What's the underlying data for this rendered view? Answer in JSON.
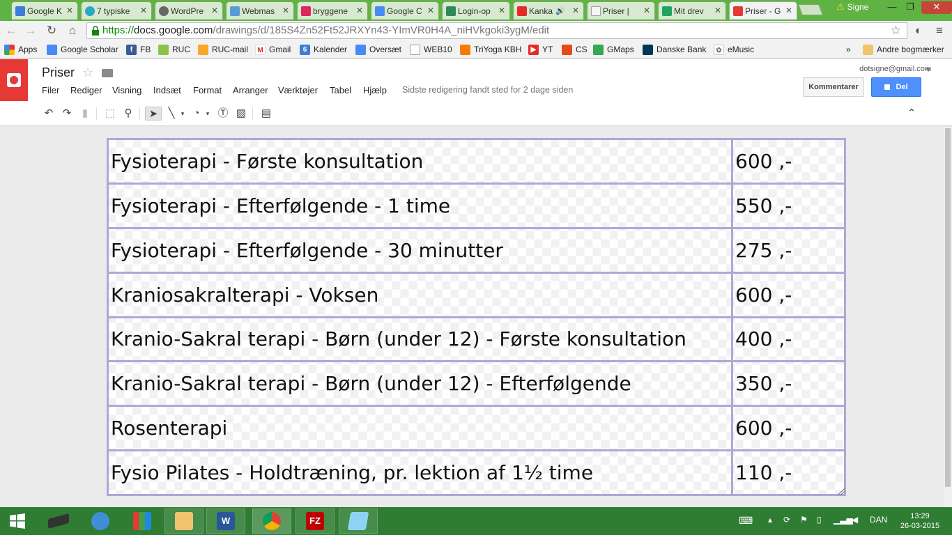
{
  "browser": {
    "tabs": [
      {
        "label": "Google K",
        "icon": "calendar-icon",
        "color": "#3d7dd8"
      },
      {
        "label": "7 typiske",
        "icon": "d-logo-icon",
        "color": "#2aa7c9"
      },
      {
        "label": "WordPre",
        "icon": "wordpress-icon",
        "color": "#666666"
      },
      {
        "label": "Webmas",
        "icon": "webmaster-icon",
        "color": "#5b9bd5"
      },
      {
        "label": "bryggene",
        "icon": "n-logo-icon",
        "color": "#e0245e"
      },
      {
        "label": "Google C",
        "icon": "translate-icon",
        "color": "#4a8af4"
      },
      {
        "label": "Login-op",
        "icon": "g-logo-icon",
        "color": "#2e8b57"
      },
      {
        "label": "Kanka",
        "icon": "youtube-icon",
        "color": "#e52d27"
      },
      {
        "label": "Priser |",
        "icon": "document-icon",
        "color": "#9e9e9e"
      },
      {
        "label": "Mit drev",
        "icon": "drive-icon",
        "color": "#1fa463"
      },
      {
        "label": "Priser - G",
        "icon": "drawings-icon",
        "color": "#e53935"
      }
    ],
    "user_badge": "Signe",
    "url_https": "https://",
    "url_host": "docs.google.com",
    "url_path": "/drawings/d/185S4Zn52Ft52JRXYn43-YImVR0H4A_niHVkgoki3ygM/edit",
    "bookmarks": [
      {
        "label": "Apps",
        "icon": "apps-icon",
        "color": "#e53935"
      },
      {
        "label": "Google Scholar",
        "icon": "scholar-icon",
        "color": "#4a8af4"
      },
      {
        "label": "FB",
        "icon": "facebook-icon",
        "color": "#3b5998"
      },
      {
        "label": "RUC",
        "icon": "ruc-icon",
        "color": "#8bc34a"
      },
      {
        "label": "RUC-mail",
        "icon": "ruc-mail-icon",
        "color": "#f9a825"
      },
      {
        "label": "Gmail",
        "icon": "gmail-icon",
        "color": "#d93025"
      },
      {
        "label": "Kalender",
        "icon": "calendar-icon",
        "color": "#3d7dd8"
      },
      {
        "label": "Oversæt",
        "icon": "translate-icon",
        "color": "#4a8af4"
      },
      {
        "label": "WEB10",
        "icon": "mail-icon",
        "color": "#9e9e9e"
      },
      {
        "label": "TriYoga KBH",
        "icon": "triyoga-icon",
        "color": "#f57c00"
      },
      {
        "label": "YT",
        "icon": "youtube-icon",
        "color": "#e52d27"
      },
      {
        "label": "CS",
        "icon": "cs-icon",
        "color": "#e64a19"
      },
      {
        "label": "GMaps",
        "icon": "maps-icon",
        "color": "#34a853"
      },
      {
        "label": "Danske Bank",
        "icon": "bank-icon",
        "color": "#003755"
      },
      {
        "label": "eMusic",
        "icon": "emusic-icon",
        "color": "#777777"
      }
    ],
    "other_bookmarks": "Andre bogmærker",
    "more_bookmarks": "»"
  },
  "docs": {
    "title": "Priser",
    "menus": [
      "Filer",
      "Rediger",
      "Visning",
      "Indsæt",
      "Format",
      "Arranger",
      "Værktøjer",
      "Tabel",
      "Hjælp"
    ],
    "last_edit": "Sidste redigering fandt sted for 2 dage siden",
    "account": "dotsigne@gmail.com",
    "comments_label": "Kommentarer",
    "share_label": "Del"
  },
  "price_table": {
    "rows": [
      {
        "service": "Fysioterapi - Første konsultation",
        "price": "600 ,-"
      },
      {
        "service": "Fysioterapi - Efterfølgende - 1 time",
        "price": "550 ,-"
      },
      {
        "service": "Fysioterapi - Efterfølgende - 30 minutter",
        "price": "275 ,-"
      },
      {
        "service": "Kraniosakralterapi - Voksen",
        "price": "600 ,-"
      },
      {
        "service": "Kranio-Sakral terapi - Børn (under 12) - Første konsultation",
        "price": "400 ,-"
      },
      {
        "service": "Kranio-Sakral terapi - Børn (under 12) - Efterfølgende",
        "price": "350 ,-"
      },
      {
        "service": "Rosenterapi",
        "price": "600 ,-"
      },
      {
        "service": "Fysio Pilates - Holdtræning, pr. lektion af 1½ time",
        "price": "110 ,-"
      }
    ],
    "border_color": "#b2a5d6"
  },
  "taskbar": {
    "language": "DAN",
    "time": "13:29",
    "date": "26-03-2015",
    "apps": [
      {
        "name": "start-button",
        "glyph": ""
      },
      {
        "name": "laptop-app-icon",
        "glyph": ""
      },
      {
        "name": "network-app-icon",
        "glyph": ""
      },
      {
        "name": "tiles-app-icon",
        "glyph": ""
      },
      {
        "name": "file-explorer-icon",
        "glyph": ""
      },
      {
        "name": "word-icon",
        "glyph": "W"
      },
      {
        "name": "chrome-icon",
        "glyph": ""
      },
      {
        "name": "filezilla-icon",
        "glyph": "FZ"
      },
      {
        "name": "notepad-app-icon",
        "glyph": ""
      }
    ]
  }
}
